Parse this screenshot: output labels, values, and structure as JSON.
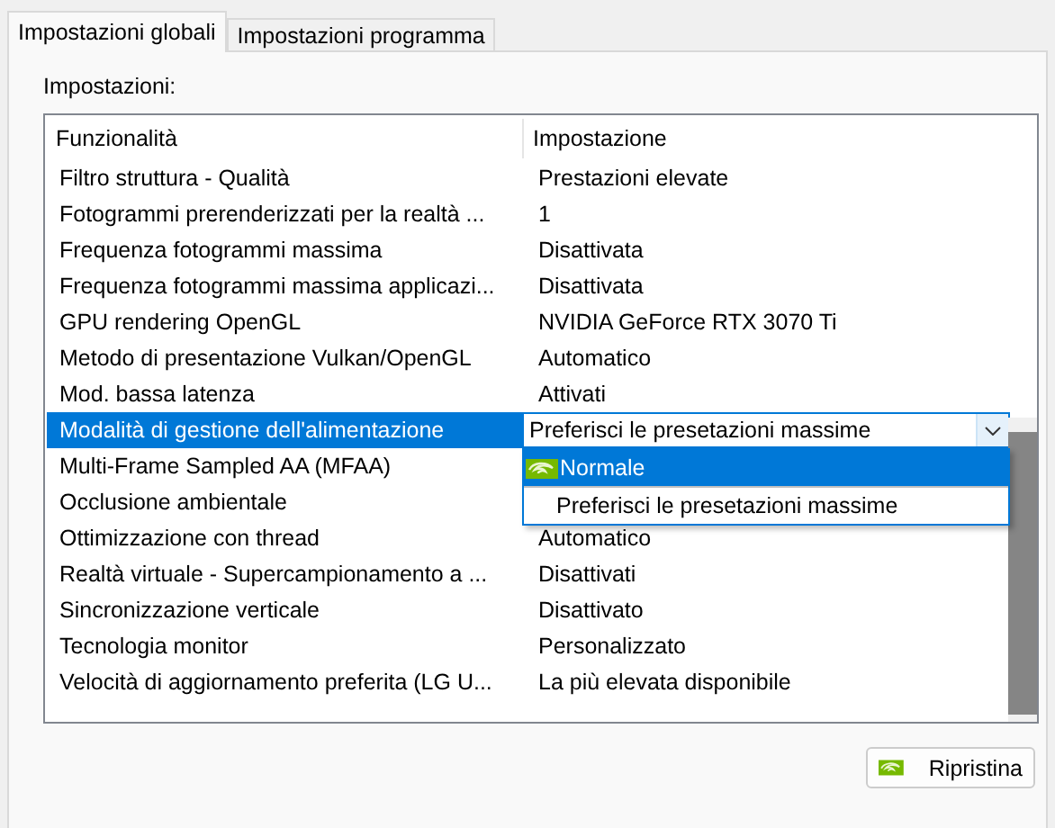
{
  "tabs": [
    {
      "label": "Impostazioni globali",
      "selected": true
    },
    {
      "label": "Impostazioni programma",
      "selected": false
    }
  ],
  "settings_label": "Impostazioni:",
  "table": {
    "columns": [
      "Funzionalità",
      "Impostazione"
    ],
    "rows": [
      {
        "feature": "Filtro struttura - Qualità",
        "value": "Prestazioni elevate",
        "selected": false
      },
      {
        "feature": "Fotogrammi prerenderizzati per la realtà ...",
        "value": "1",
        "selected": false
      },
      {
        "feature": "Frequenza fotogrammi massima",
        "value": "Disattivata",
        "selected": false
      },
      {
        "feature": "Frequenza fotogrammi massima applicazi...",
        "value": "Disattivata",
        "selected": false
      },
      {
        "feature": "GPU rendering OpenGL",
        "value": "NVIDIA GeForce RTX 3070 Ti",
        "selected": false
      },
      {
        "feature": "Metodo di presentazione Vulkan/OpenGL",
        "value": "Automatico",
        "selected": false
      },
      {
        "feature": "Mod. bassa latenza",
        "value": "Attivati",
        "selected": false
      },
      {
        "feature": "Modalità di gestione dell'alimentazione",
        "value": "Preferisci le presetazioni massime",
        "selected": true,
        "dropdown": {
          "options": [
            {
              "label": "Normale",
              "selected": true
            },
            {
              "label": "Preferisci le presetazioni massime",
              "selected": false
            }
          ]
        }
      },
      {
        "feature": "Multi-Frame Sampled AA (MFAA)",
        "selected": false
      },
      {
        "feature": "Occlusione ambientale",
        "selected": false
      },
      {
        "feature": "Ottimizzazione con thread",
        "value": "Automatico",
        "selected": false
      },
      {
        "feature": "Realtà virtuale - Supercampionamento a ...",
        "value": "Disattivati",
        "selected": false
      },
      {
        "feature": "Sincronizzazione verticale",
        "value": "Disattivato",
        "selected": false
      },
      {
        "feature": "Tecnologia monitor",
        "value": "Personalizzato",
        "selected": false
      },
      {
        "feature": "Velocità di aggiornamento preferita (LG U...",
        "value": "La più elevata disponibile",
        "selected": false
      }
    ]
  },
  "restore_button": {
    "label": "Ripristina"
  }
}
